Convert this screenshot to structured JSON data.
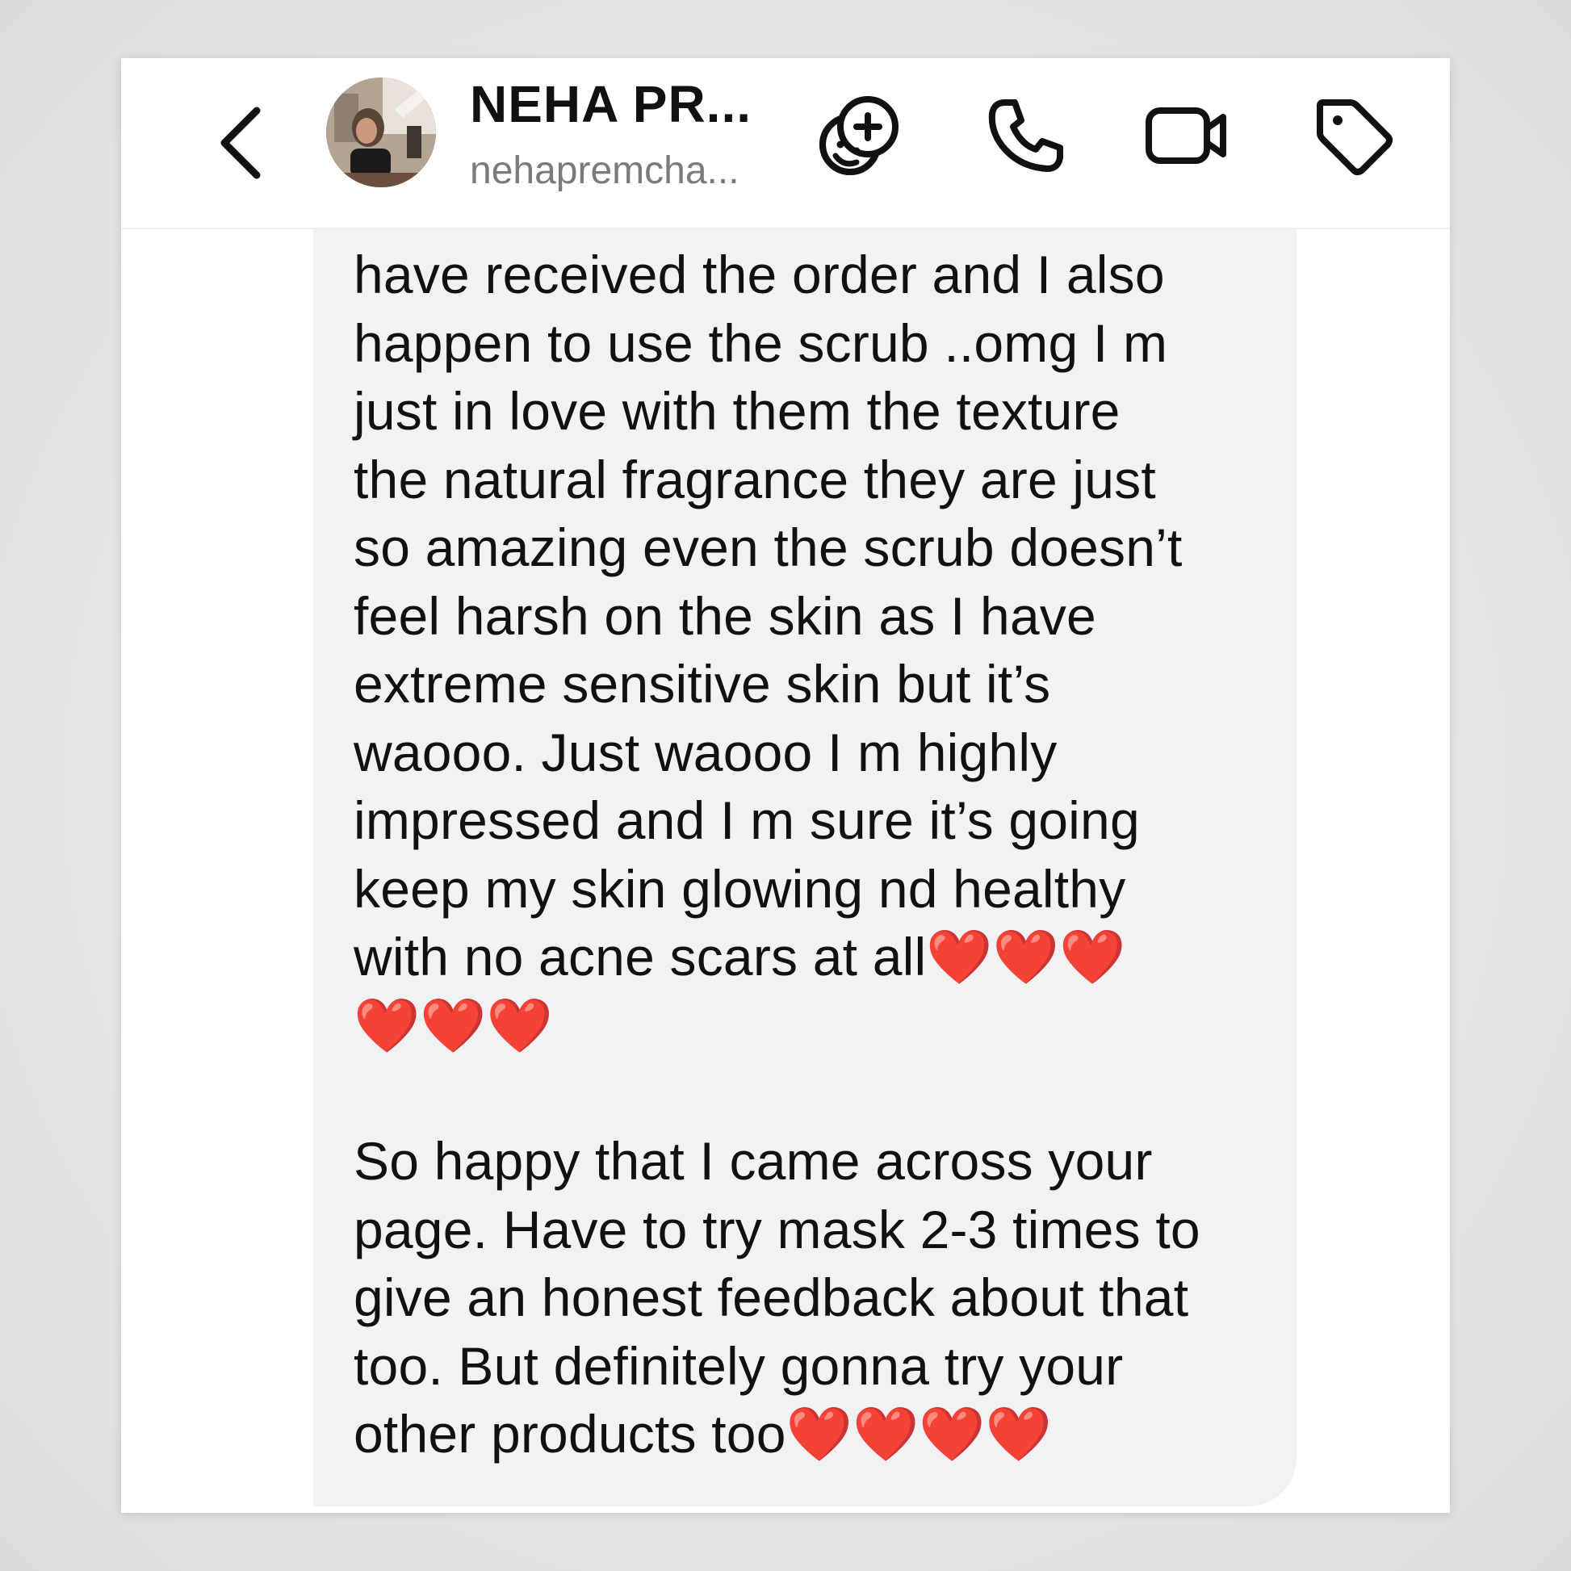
{
  "header": {
    "back_icon": "chevron-left-icon",
    "contact_name": "NEHA PR...",
    "contact_handle": "nehapremcha...",
    "actions": [
      {
        "name": "add-effect",
        "icon": "face-plus-icon"
      },
      {
        "name": "call",
        "icon": "phone-icon"
      },
      {
        "name": "video-call",
        "icon": "video-icon"
      },
      {
        "name": "label",
        "icon": "tag-icon"
      }
    ]
  },
  "message": {
    "lines": [
      "have received the order and I also",
      "happen to use the scrub ..omg I m",
      "just in love with them the texture",
      "the natural fragrance they are just",
      "so amazing even the scrub doesn’t",
      "feel harsh on the skin as I have",
      "extreme sensitive skin but it’s",
      "waooo. Just waooo I m highly",
      "impressed and I m sure it’s going",
      "keep my skin glowing nd healthy",
      "with no acne scars at all"
    ],
    "line11_hearts": "❤️❤️❤️",
    "line12_hearts": "❤️❤️❤️",
    "paragraph2": [
      "So happy that I came across your",
      "page. Have to try mask 2-3 times to",
      "give an honest feedback about that",
      "too. But definitely gonna try your",
      "other products too"
    ],
    "paragraph2_hearts": "❤️❤️❤️❤️"
  },
  "colors": {
    "bubble": "#f2f2f4",
    "heart": "#e0151b",
    "text": "#111111",
    "handle": "#7a7a7a"
  }
}
